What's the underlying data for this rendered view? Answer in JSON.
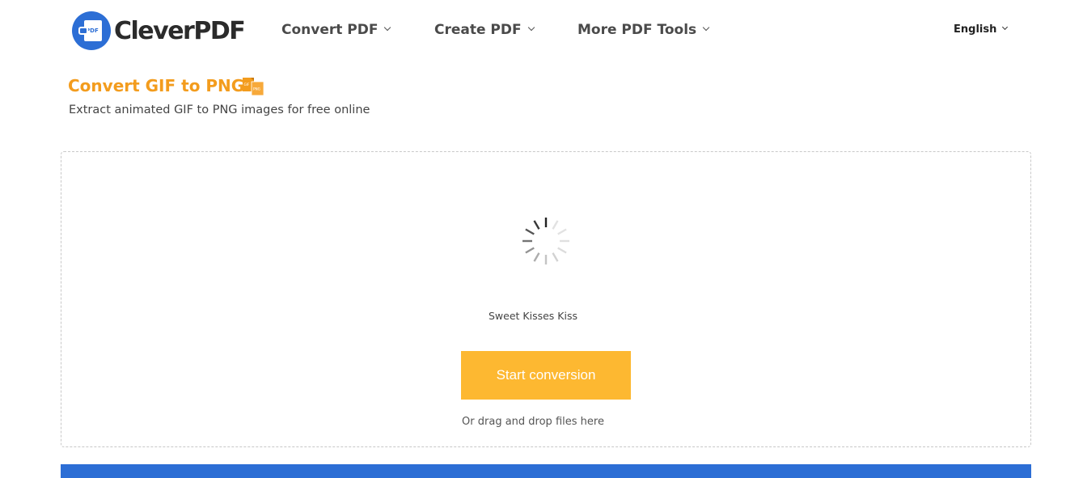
{
  "brand": {
    "name": "CleverPDF",
    "mark_text": "PDF",
    "color": "#2c6ed5"
  },
  "nav": {
    "items": [
      {
        "label": "Convert PDF"
      },
      {
        "label": "Create PDF"
      },
      {
        "label": "More PDF Tools"
      }
    ],
    "language": "English"
  },
  "page": {
    "title": "Convert GIF to PNG",
    "title_icon": "gif-to-png-icon",
    "title_icon_labels": {
      "from": "GIF",
      "to": "PNG"
    },
    "subtitle": "Extract animated GIF to PNG images for free online",
    "accent_color": "#f39c1d"
  },
  "upload": {
    "status_icon": "loading-spinner-icon",
    "file_name": "Sweet Kisses Kiss",
    "start_label": "Start conversion",
    "button_color": "#fdb831",
    "drag_hint": "Or drag and drop files here"
  }
}
